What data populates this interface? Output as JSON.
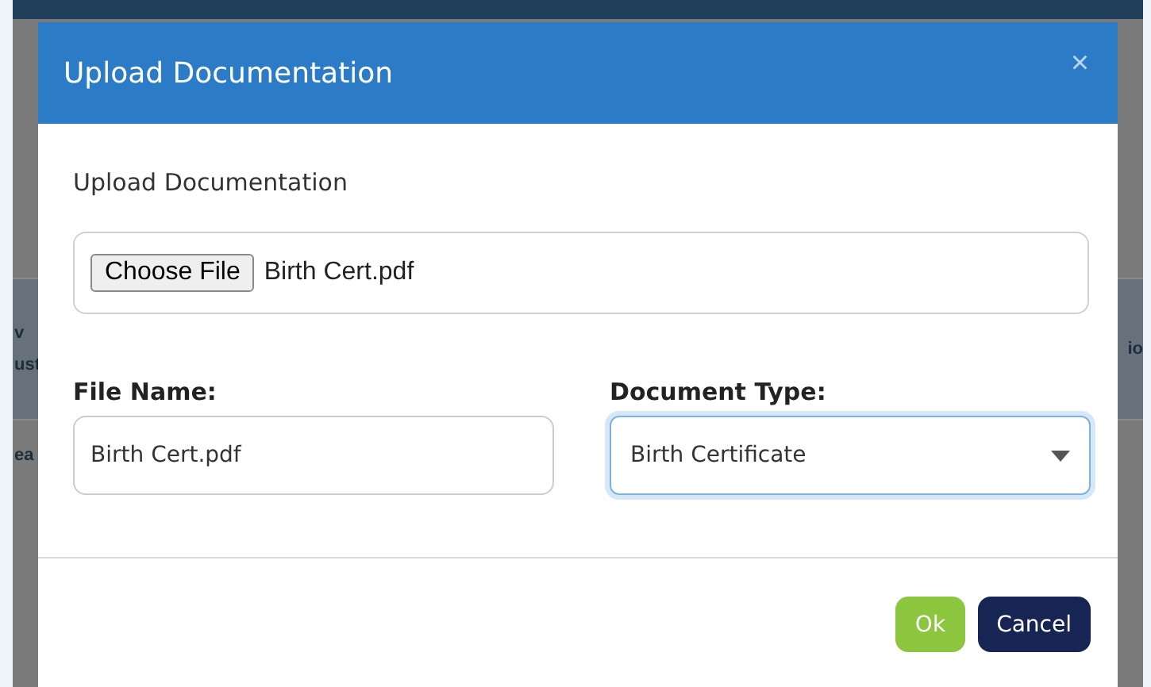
{
  "background": {
    "fragments_left": [
      "v",
      "ust",
      "ea"
    ],
    "fragments_right": [
      "io"
    ]
  },
  "dialog": {
    "title": "Upload Documentation",
    "close": "×",
    "upload": {
      "label": "Upload Documentation",
      "button": "Choose File",
      "file": "Birth Cert.pdf"
    },
    "file_name": {
      "label": "File Name:",
      "value": "Birth Cert.pdf"
    },
    "document_type": {
      "label": "Document Type:",
      "value": "Birth Certificate",
      "focused": true
    },
    "buttons": [
      {
        "label": "Ok",
        "kind": "primary"
      },
      {
        "label": "Cancel",
        "kind": "secondary"
      }
    ]
  }
}
